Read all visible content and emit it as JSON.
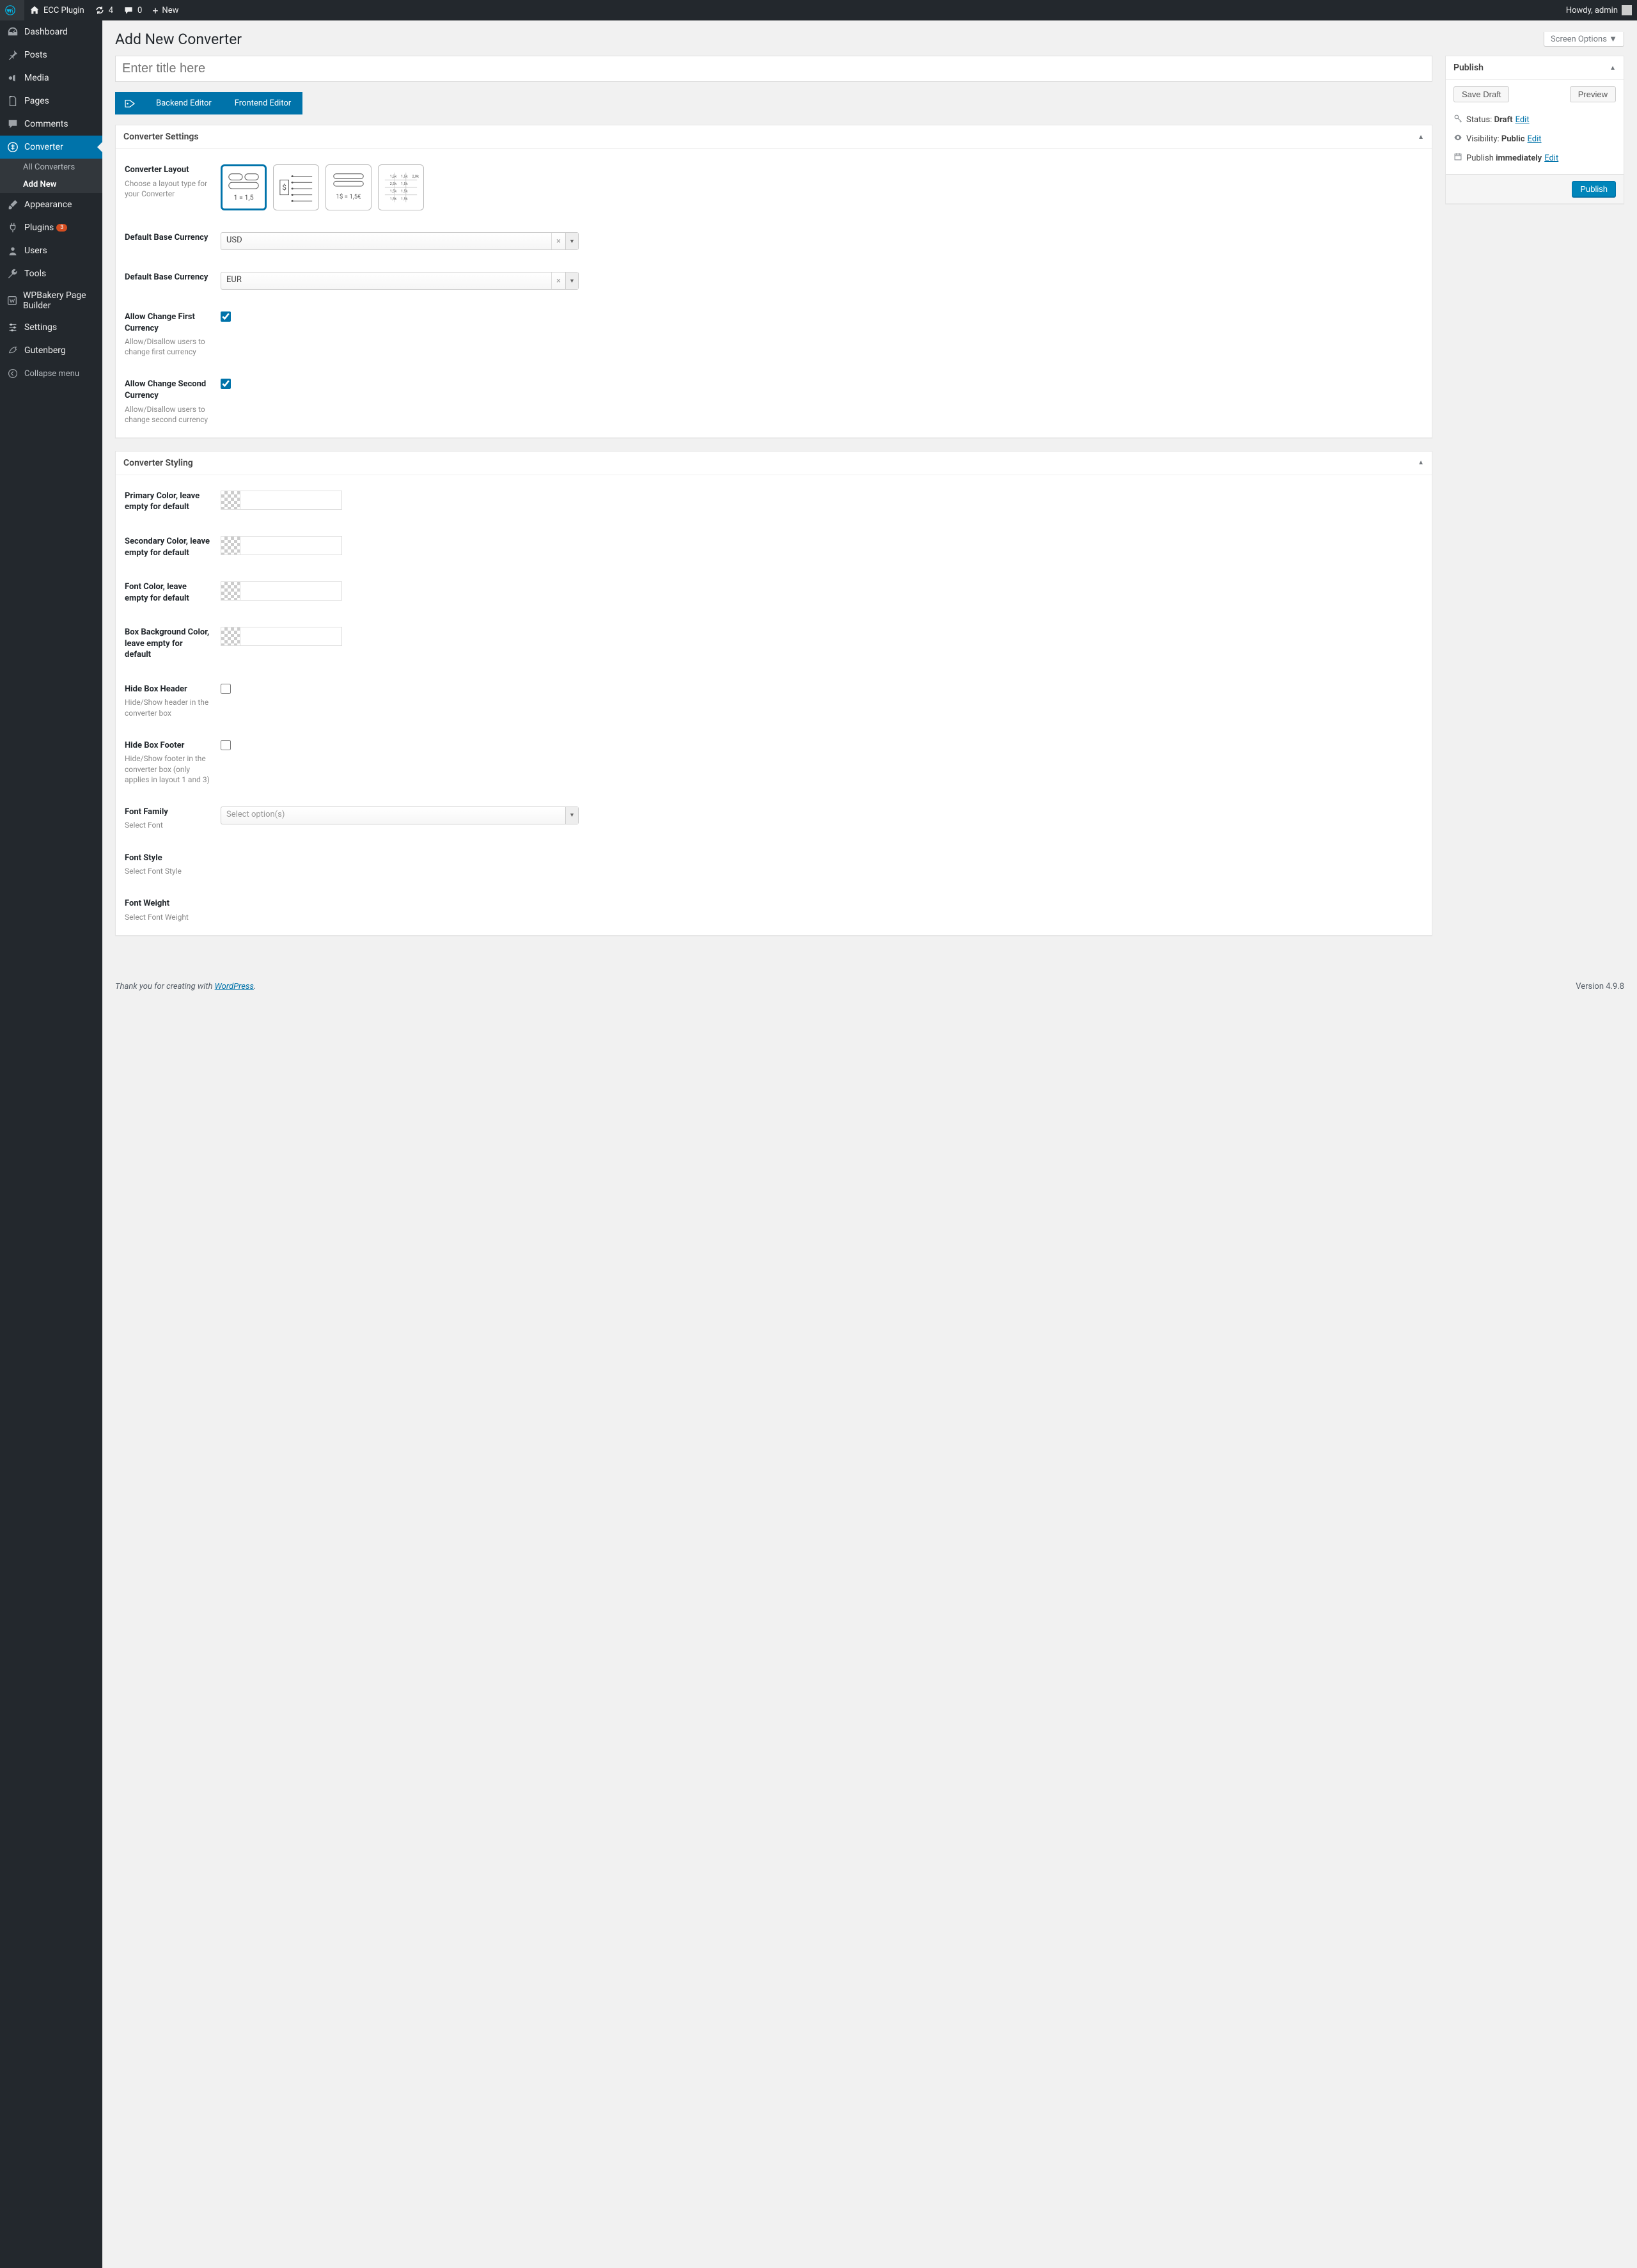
{
  "adminbar": {
    "site_name": "ECC Plugin",
    "updates": "4",
    "comments": "0",
    "new": "New",
    "howdy": "Howdy, admin"
  },
  "sidebar": {
    "items": [
      {
        "icon": "dash",
        "label": "Dashboard"
      },
      {
        "icon": "pin",
        "label": "Posts"
      },
      {
        "icon": "media",
        "label": "Media"
      },
      {
        "icon": "page",
        "label": "Pages"
      },
      {
        "icon": "comment",
        "label": "Comments"
      },
      {
        "icon": "converter",
        "label": "Converter",
        "current": true,
        "sub": [
          {
            "label": "All Converters"
          },
          {
            "label": "Add New",
            "current": true
          }
        ]
      },
      {
        "icon": "brush",
        "label": "Appearance"
      },
      {
        "icon": "plug",
        "label": "Plugins",
        "badge": "3"
      },
      {
        "icon": "user",
        "label": "Users"
      },
      {
        "icon": "wrench",
        "label": "Tools"
      },
      {
        "icon": "wp",
        "label": "WPBakery Page Builder"
      },
      {
        "icon": "sliders",
        "label": "Settings"
      },
      {
        "icon": "gutenberg",
        "label": "Gutenberg"
      }
    ],
    "collapse": "Collapse menu"
  },
  "header": {
    "screen_options": "Screen Options",
    "page_title": "Add New Converter",
    "title_placeholder": "Enter title here"
  },
  "editor_tabs": {
    "backend": "Backend Editor",
    "frontend": "Frontend Editor"
  },
  "settings_box": {
    "title": "Converter Settings",
    "rows": {
      "layout": {
        "label": "Converter Layout",
        "desc": "Choose a layout type for your Converter"
      },
      "base1": {
        "label": "Default Base Currency",
        "value": "USD"
      },
      "base2": {
        "label": "Default Base Currency",
        "value": "EUR"
      },
      "allow1": {
        "label": "Allow Change First Currency",
        "desc": "Allow/Disallow users to change first currency"
      },
      "allow2": {
        "label": "Allow Change Second Currency",
        "desc": "Allow/Disallow users to change second currency"
      }
    }
  },
  "styling_box": {
    "title": "Converter Styling",
    "rows": {
      "primary": {
        "label": "Primary Color, leave empty for default"
      },
      "secondary": {
        "label": "Secondary Color, leave empty for default"
      },
      "font_color": {
        "label": "Font Color, leave empty for default"
      },
      "box_bg": {
        "label": "Box Background Color, leave empty for default"
      },
      "hide_header": {
        "label": "Hide Box Header",
        "desc": "Hide/Show header in the converter box"
      },
      "hide_footer": {
        "label": "Hide Box Footer",
        "desc": "Hide/Show footer in the converter box (only applies in layout 1 and 3)"
      },
      "font_family": {
        "label": "Font Family",
        "desc": "Select Font",
        "placeholder": "Select option(s)"
      },
      "font_style": {
        "label": "Font Style",
        "desc": "Select Font Style"
      },
      "font_weight": {
        "label": "Font Weight",
        "desc": "Select Font Weight"
      }
    }
  },
  "publish": {
    "title": "Publish",
    "save_draft": "Save Draft",
    "preview": "Preview",
    "status_label": "Status:",
    "status_value": "Draft",
    "visibility_label": "Visibility:",
    "visibility_value": "Public",
    "schedule_label": "Publish",
    "schedule_value": "immediately",
    "edit": "Edit",
    "publish_btn": "Publish"
  },
  "footer": {
    "thank_you_pre": "Thank you for creating with ",
    "thank_you_link": "WordPress",
    "version": "Version 4.9.8"
  }
}
